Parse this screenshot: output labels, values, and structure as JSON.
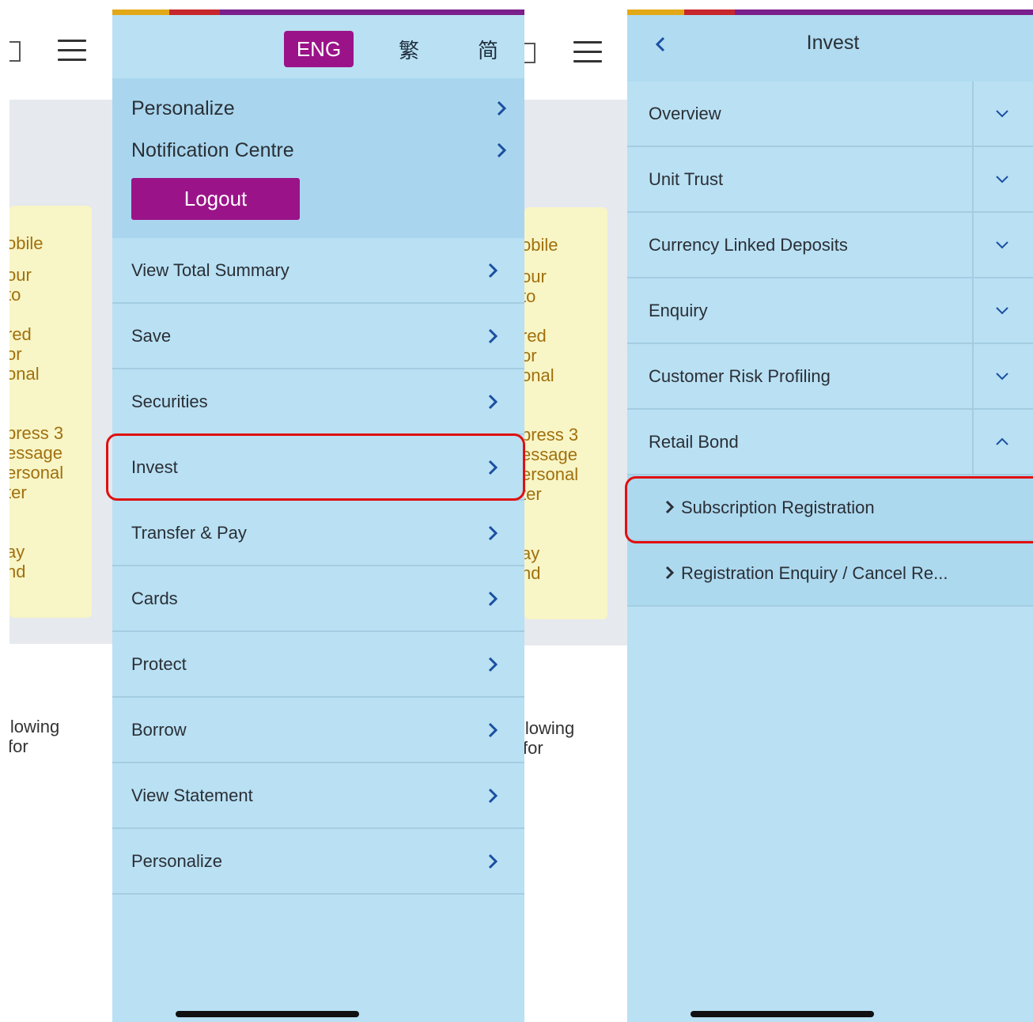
{
  "colors": {
    "menu_bg": "#b9e0f3",
    "account_bg": "#a9d6ee",
    "accent_purple": "#9b1389",
    "chevron_blue": "#1a4fa0",
    "highlight_red": "#e01010",
    "stripe_yellow": "#e3a817",
    "stripe_red": "#c7262d",
    "stripe_purple": "#7a1f8c"
  },
  "background_app": {
    "card_lines": [
      "obile",
      "our",
      " to",
      "red",
      "or",
      "onal",
      "press 3",
      "essage",
      "ersonal",
      "ter",
      "ay",
      "nd"
    ],
    "text_lines": [
      "llowing",
      "for"
    ],
    "icons": [
      "hamburger-icon",
      "external-link-icon"
    ]
  },
  "language_selector": {
    "active": "ENG",
    "traditional": "繁",
    "simplified": "简"
  },
  "account": {
    "items": [
      {
        "label": "Personalize",
        "icon": "chevron-right-icon"
      },
      {
        "label": "Notification Centre",
        "icon": "chevron-right-icon"
      }
    ],
    "logout_label": "Logout"
  },
  "menu": {
    "items": [
      {
        "label": "View Total Summary"
      },
      {
        "label": "Save"
      },
      {
        "label": "Securities"
      },
      {
        "label": "Invest",
        "highlighted": true
      },
      {
        "label": "Transfer & Pay"
      },
      {
        "label": "Cards"
      },
      {
        "label": "Protect"
      },
      {
        "label": "Borrow"
      },
      {
        "label": "View Statement"
      },
      {
        "label": "Personalize"
      }
    ]
  },
  "invest": {
    "title": "Invest",
    "back_icon": "chevron-left-icon",
    "sections": [
      {
        "label": "Overview",
        "expanded": false
      },
      {
        "label": "Unit Trust",
        "expanded": false
      },
      {
        "label": "Currency Linked Deposits",
        "expanded": false
      },
      {
        "label": "Enquiry",
        "expanded": false
      },
      {
        "label": "Customer Risk Profiling",
        "expanded": false
      },
      {
        "label": "Retail Bond",
        "expanded": true
      }
    ],
    "retail_bond_items": [
      {
        "label": "Subscription Registration",
        "highlighted": true
      },
      {
        "label": "Registration Enquiry / Cancel Re..."
      }
    ]
  }
}
